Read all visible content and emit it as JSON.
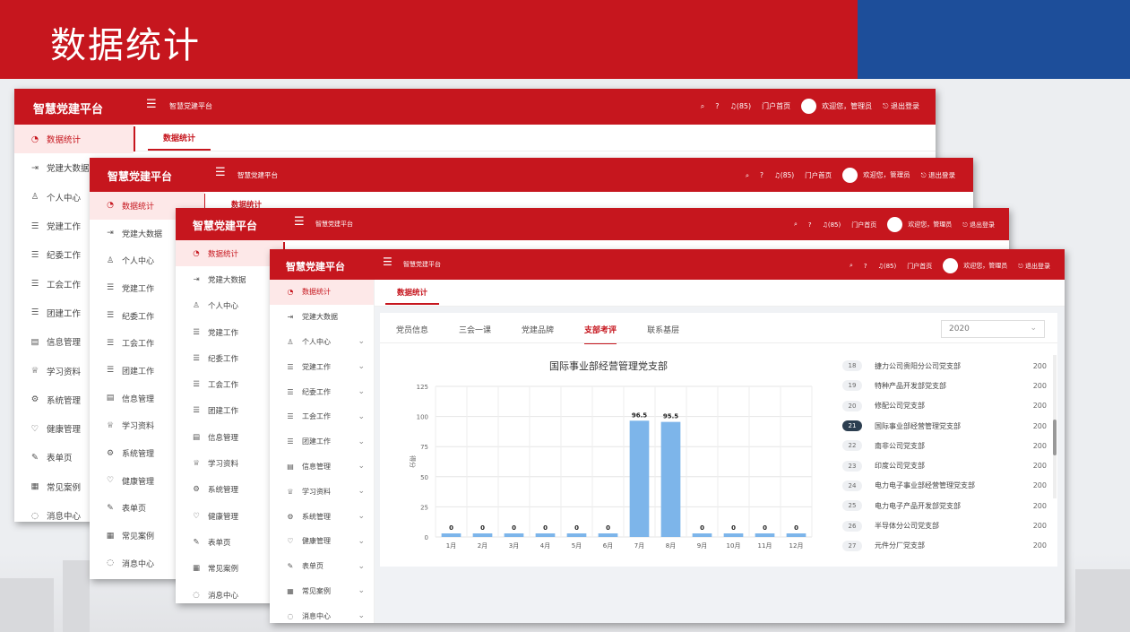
{
  "slide": {
    "title": "数据统计"
  },
  "app": {
    "logo": "智慧党建平台",
    "crumb": "智慧党建平台",
    "header_items": {
      "badge": "(85)",
      "portal": "门户首页",
      "welcome": "欢迎您，管理员",
      "logout": "退出登录"
    },
    "active_tab": "数据统计"
  },
  "sidebar": {
    "items": [
      {
        "label": "数据统计",
        "icon": "pie-chart-icon"
      },
      {
        "label": "党建大数据",
        "icon": "login-arrow-icon"
      },
      {
        "label": "个人中心",
        "icon": "user-icon"
      },
      {
        "label": "党建工作",
        "icon": "list-icon"
      },
      {
        "label": "纪委工作",
        "icon": "list-icon"
      },
      {
        "label": "工会工作",
        "icon": "list-icon"
      },
      {
        "label": "团建工作",
        "icon": "list-icon"
      },
      {
        "label": "信息管理",
        "icon": "document-icon"
      },
      {
        "label": "学习资料",
        "icon": "trophy-icon"
      },
      {
        "label": "系统管理",
        "icon": "gear-icon"
      },
      {
        "label": "健康管理",
        "icon": "heart-icon"
      },
      {
        "label": "表单页",
        "icon": "edit-icon"
      },
      {
        "label": "常见案例",
        "icon": "grid-icon"
      },
      {
        "label": "消息中心",
        "icon": "chat-icon"
      }
    ]
  },
  "subtabs": [
    "党员信息",
    "三会一课",
    "党建品牌",
    "支部考评",
    "联系基层"
  ],
  "active_subtab": 3,
  "year": "2020",
  "chart_data": {
    "type": "bar",
    "title": "国际事业部经营管理党支部",
    "ylabel": "得分",
    "categories": [
      "1月",
      "2月",
      "3月",
      "4月",
      "5月",
      "6月",
      "7月",
      "8月",
      "9月",
      "10月",
      "11月",
      "12月"
    ],
    "values": [
      0,
      0,
      0,
      0,
      0,
      0,
      96.5,
      95.5,
      0,
      0,
      0,
      0
    ],
    "ylim": [
      0,
      125
    ],
    "yticks": [
      0,
      25,
      50,
      75,
      100,
      125
    ],
    "grid": true,
    "color": "#7db5ea"
  },
  "ranking": [
    {
      "rank": "18",
      "name": "捷力公司贵阳分公司党支部",
      "score": "200"
    },
    {
      "rank": "19",
      "name": "特种产品开发部党支部",
      "score": "200"
    },
    {
      "rank": "20",
      "name": "修配公司党支部",
      "score": "200"
    },
    {
      "rank": "21",
      "name": "国际事业部经营管理党支部",
      "score": "200"
    },
    {
      "rank": "22",
      "name": "南非公司党支部",
      "score": "200"
    },
    {
      "rank": "23",
      "name": "印度公司党支部",
      "score": "200"
    },
    {
      "rank": "24",
      "name": "电力电子事业部经营管理党支部",
      "score": "200"
    },
    {
      "rank": "25",
      "name": "电力电子产品开发部党支部",
      "score": "200"
    },
    {
      "rank": "26",
      "name": "半导体分公司党支部",
      "score": "200"
    },
    {
      "rank": "27",
      "name": "元件分厂党支部",
      "score": "200"
    }
  ],
  "active_rank": "21"
}
